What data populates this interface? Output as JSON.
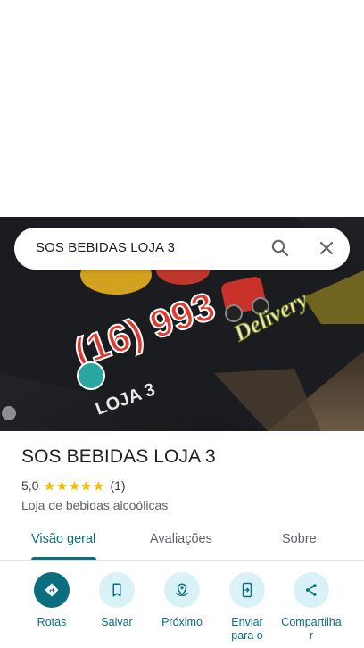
{
  "search": {
    "query": "SOS BEBIDAS LOJA 3"
  },
  "hero": {
    "sign_phone": "(16) 993",
    "sign_store": "LOJA 3",
    "sign_delivery": "Delivery"
  },
  "place": {
    "title": "SOS BEBIDAS LOJA 3",
    "rating": "5,0",
    "stars": 5,
    "reviews": "(1)",
    "category": "Loja de bebidas alcoólicas"
  },
  "tabs": [
    {
      "label": "Visão geral",
      "active": true
    },
    {
      "label": "Avaliações",
      "active": false
    },
    {
      "label": "Sobre",
      "active": false
    }
  ],
  "actions": [
    {
      "label": "Rotas",
      "icon": "directions-icon"
    },
    {
      "label": "Salvar",
      "icon": "bookmark-icon"
    },
    {
      "label": "Próximo",
      "icon": "nearby-icon"
    },
    {
      "label": "Enviar para o",
      "icon": "send-to-phone-icon"
    },
    {
      "label": "Compartilha r",
      "icon": "share-icon"
    }
  ],
  "colors": {
    "accent": "#0b6e7e",
    "accent_light": "#d8f2f8",
    "star": "#fbbc04"
  }
}
